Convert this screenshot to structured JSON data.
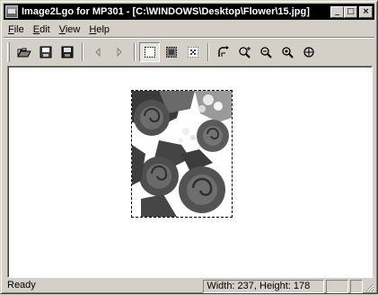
{
  "window": {
    "title": "Image2Lgo for MP301 - [C:\\WINDOWS\\Desktop\\Flower\\15.jpg]",
    "caption_buttons": {
      "minimize": "_",
      "maximize": "□",
      "close": "×"
    }
  },
  "menu": {
    "items": [
      {
        "hotkey": "F",
        "rest": "ile"
      },
      {
        "hotkey": "E",
        "rest": "dit"
      },
      {
        "hotkey": "V",
        "rest": "iew"
      },
      {
        "hotkey": "H",
        "rest": "elp"
      }
    ]
  },
  "toolbar": {
    "buttons": [
      "open-folder-icon",
      "save-icon",
      "save-as-icon",
      "previous-icon",
      "next-icon",
      "select-frame-icon",
      "crop-fill-icon",
      "dither-pattern-icon",
      "rotate-icon",
      "zoom-in-icon",
      "zoom-out-icon",
      "zoom-actual-icon",
      "zoom-fit-icon"
    ],
    "pressed": "select-frame-icon"
  },
  "status": {
    "message": "Ready",
    "dimensions": "Width: 237, Height: 178"
  },
  "image": {
    "description_icon": "flower-photo"
  }
}
